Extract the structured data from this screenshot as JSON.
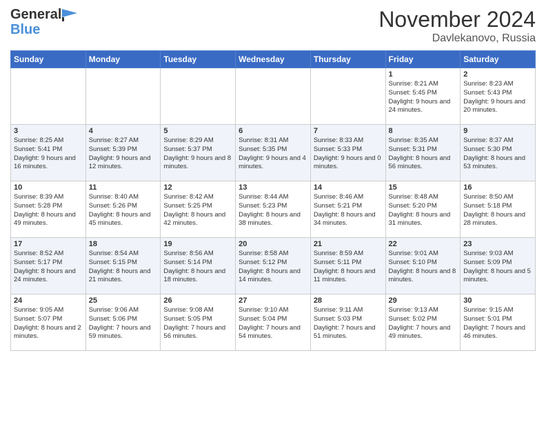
{
  "header": {
    "logo_line1": "General",
    "logo_line2": "Blue",
    "month_title": "November 2024",
    "location": "Davlekanovo, Russia"
  },
  "days_of_week": [
    "Sunday",
    "Monday",
    "Tuesday",
    "Wednesday",
    "Thursday",
    "Friday",
    "Saturday"
  ],
  "weeks": [
    [
      {
        "day": "",
        "info": ""
      },
      {
        "day": "",
        "info": ""
      },
      {
        "day": "",
        "info": ""
      },
      {
        "day": "",
        "info": ""
      },
      {
        "day": "",
        "info": ""
      },
      {
        "day": "1",
        "info": "Sunrise: 8:21 AM\nSunset: 5:45 PM\nDaylight: 9 hours and 24 minutes."
      },
      {
        "day": "2",
        "info": "Sunrise: 8:23 AM\nSunset: 5:43 PM\nDaylight: 9 hours and 20 minutes."
      }
    ],
    [
      {
        "day": "3",
        "info": "Sunrise: 8:25 AM\nSunset: 5:41 PM\nDaylight: 9 hours and 16 minutes."
      },
      {
        "day": "4",
        "info": "Sunrise: 8:27 AM\nSunset: 5:39 PM\nDaylight: 9 hours and 12 minutes."
      },
      {
        "day": "5",
        "info": "Sunrise: 8:29 AM\nSunset: 5:37 PM\nDaylight: 9 hours and 8 minutes."
      },
      {
        "day": "6",
        "info": "Sunrise: 8:31 AM\nSunset: 5:35 PM\nDaylight: 9 hours and 4 minutes."
      },
      {
        "day": "7",
        "info": "Sunrise: 8:33 AM\nSunset: 5:33 PM\nDaylight: 9 hours and 0 minutes."
      },
      {
        "day": "8",
        "info": "Sunrise: 8:35 AM\nSunset: 5:31 PM\nDaylight: 8 hours and 56 minutes."
      },
      {
        "day": "9",
        "info": "Sunrise: 8:37 AM\nSunset: 5:30 PM\nDaylight: 8 hours and 53 minutes."
      }
    ],
    [
      {
        "day": "10",
        "info": "Sunrise: 8:39 AM\nSunset: 5:28 PM\nDaylight: 8 hours and 49 minutes."
      },
      {
        "day": "11",
        "info": "Sunrise: 8:40 AM\nSunset: 5:26 PM\nDaylight: 8 hours and 45 minutes."
      },
      {
        "day": "12",
        "info": "Sunrise: 8:42 AM\nSunset: 5:25 PM\nDaylight: 8 hours and 42 minutes."
      },
      {
        "day": "13",
        "info": "Sunrise: 8:44 AM\nSunset: 5:23 PM\nDaylight: 8 hours and 38 minutes."
      },
      {
        "day": "14",
        "info": "Sunrise: 8:46 AM\nSunset: 5:21 PM\nDaylight: 8 hours and 34 minutes."
      },
      {
        "day": "15",
        "info": "Sunrise: 8:48 AM\nSunset: 5:20 PM\nDaylight: 8 hours and 31 minutes."
      },
      {
        "day": "16",
        "info": "Sunrise: 8:50 AM\nSunset: 5:18 PM\nDaylight: 8 hours and 28 minutes."
      }
    ],
    [
      {
        "day": "17",
        "info": "Sunrise: 8:52 AM\nSunset: 5:17 PM\nDaylight: 8 hours and 24 minutes."
      },
      {
        "day": "18",
        "info": "Sunrise: 8:54 AM\nSunset: 5:15 PM\nDaylight: 8 hours and 21 minutes."
      },
      {
        "day": "19",
        "info": "Sunrise: 8:56 AM\nSunset: 5:14 PM\nDaylight: 8 hours and 18 minutes."
      },
      {
        "day": "20",
        "info": "Sunrise: 8:58 AM\nSunset: 5:12 PM\nDaylight: 8 hours and 14 minutes."
      },
      {
        "day": "21",
        "info": "Sunrise: 8:59 AM\nSunset: 5:11 PM\nDaylight: 8 hours and 11 minutes."
      },
      {
        "day": "22",
        "info": "Sunrise: 9:01 AM\nSunset: 5:10 PM\nDaylight: 8 hours and 8 minutes."
      },
      {
        "day": "23",
        "info": "Sunrise: 9:03 AM\nSunset: 5:09 PM\nDaylight: 8 hours and 5 minutes."
      }
    ],
    [
      {
        "day": "24",
        "info": "Sunrise: 9:05 AM\nSunset: 5:07 PM\nDaylight: 8 hours and 2 minutes."
      },
      {
        "day": "25",
        "info": "Sunrise: 9:06 AM\nSunset: 5:06 PM\nDaylight: 7 hours and 59 minutes."
      },
      {
        "day": "26",
        "info": "Sunrise: 9:08 AM\nSunset: 5:05 PM\nDaylight: 7 hours and 56 minutes."
      },
      {
        "day": "27",
        "info": "Sunrise: 9:10 AM\nSunset: 5:04 PM\nDaylight: 7 hours and 54 minutes."
      },
      {
        "day": "28",
        "info": "Sunrise: 9:11 AM\nSunset: 5:03 PM\nDaylight: 7 hours and 51 minutes."
      },
      {
        "day": "29",
        "info": "Sunrise: 9:13 AM\nSunset: 5:02 PM\nDaylight: 7 hours and 49 minutes."
      },
      {
        "day": "30",
        "info": "Sunrise: 9:15 AM\nSunset: 5:01 PM\nDaylight: 7 hours and 46 minutes."
      }
    ]
  ]
}
